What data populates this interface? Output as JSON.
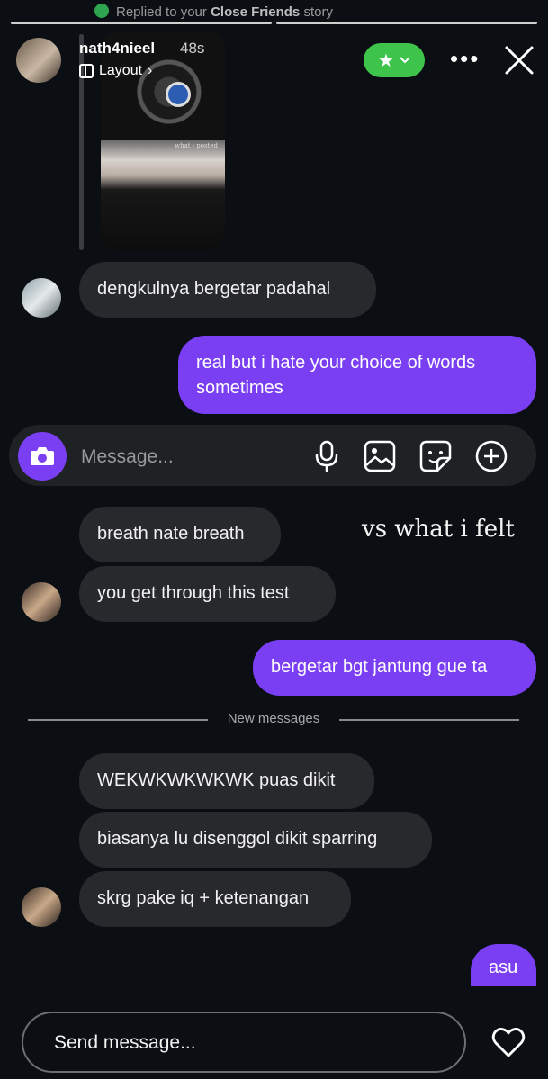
{
  "story_header": {
    "replied_prefix": "Replied to your",
    "replied_target": "Close Friends",
    "replied_suffix": "story",
    "username": "nath4nieel",
    "time": "48s",
    "layout_label": "Layout",
    "story_caption": "what i posted"
  },
  "composer": {
    "placeholder": "Message...",
    "icons": [
      "camera-icon",
      "microphone-icon",
      "gallery-icon",
      "sticker-icon",
      "plus-icon"
    ]
  },
  "messages": {
    "m1": "dengkulnya bergetar padahal",
    "m2": "real but i hate your choice of words sometimes",
    "m3": "breath nate breath",
    "m4": "you get through this test",
    "m5": "bergetar bgt jantung gue ta",
    "m6": "WEKWKWKWKWK puas dikit",
    "m7": "biasanya lu disenggol dikit sparring",
    "m8": "skrg pake iq + ketenangan",
    "m9": "asu"
  },
  "overlay_text": "vs what i felt",
  "new_messages_label": "New messages",
  "footer": {
    "placeholder": "Send message..."
  },
  "colors": {
    "background": "#0b0f14",
    "sent_bubble": "#7a3ff3",
    "received_bubble": "#27292c",
    "close_friends": "#3ec44a"
  }
}
